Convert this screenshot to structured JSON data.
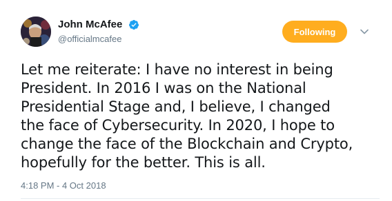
{
  "tweet": {
    "author": {
      "display_name": "John McAfee",
      "handle": "@officialmcafee",
      "verified": true,
      "avatar_icon": "profile-photo"
    },
    "follow_button_label": "Following",
    "menu_icon": "chevron-down-icon",
    "text_lines": [
      "Let me reiterate: I have no interest in being",
      "President. In 2016 I was on the National",
      "Presidential Stage and, I believe, I changed",
      "the face of Cybersecurity. In 2020, I hope to",
      "change the face of the Blockchain and Crypto,",
      "hopefully for the better. This is all."
    ],
    "timestamp": "4:18 PM - 4 Oct 2018"
  },
  "colors": {
    "follow_button_bg": "#ffad1f",
    "verified_badge": "#1da1f2",
    "secondary_text": "#657786",
    "primary_text": "#14171a"
  }
}
